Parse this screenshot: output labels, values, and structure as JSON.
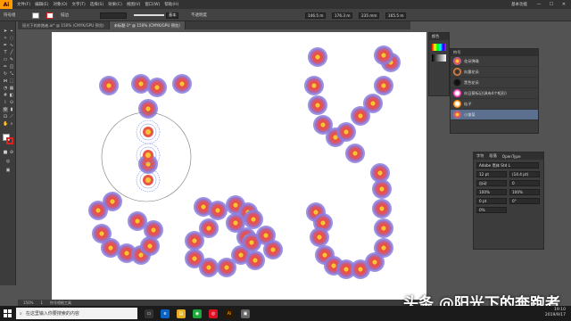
{
  "app": {
    "logo": "Ai",
    "workspace": "基本功能"
  },
  "menu": {
    "items": [
      "文件(F)",
      "编辑(E)",
      "对象(O)",
      "文字(T)",
      "选择(S)",
      "效果(C)",
      "视图(V)",
      "窗口(W)",
      "帮助(H)"
    ]
  },
  "window": {
    "min": "—",
    "max": "☐",
    "close": "✕"
  },
  "control": {
    "selection_label": "符号组",
    "stroke_label": "描边",
    "style_label": "基本",
    "opacity_label": "不透明度",
    "x_value": "146.5 m",
    "y_value": "176.3 m",
    "w_value": "235 mm",
    "h_value": "165.5 m"
  },
  "tabs": [
    {
      "label": "阳光下的奔跑者.ai* @ 150% (CMYK/GPU 预览)",
      "active": false
    },
    {
      "label": "未标题-1* @ 150% (CMYK/GPU 预览)",
      "active": true
    }
  ],
  "status": {
    "zoom": "150%",
    "page": "1",
    "tool": "符号喷枪工具"
  },
  "panels": {
    "swatch_tabs": [
      "颜色",
      "颜色参考"
    ],
    "symbols_title": "符号",
    "symbols": [
      "花朵弹珠",
      "向量花朵",
      "黑色花朵",
      "向日葵标记(具有4个矩形)",
      "桔子",
      "小雏菊"
    ],
    "selected_symbol": "小雏菊",
    "char_tabs": [
      "字符",
      "段落",
      "OpenType"
    ],
    "font_family": "Adobe 黑体 Std L",
    "font_size": "12 pt",
    "leading": "(14.4 pt)",
    "tracking": "0",
    "scale_h": "100%",
    "scale_v": "100%",
    "baseline": "0 pt",
    "rotation": "0°",
    "kerning": "自动",
    "tsume": "0%"
  },
  "taskbar": {
    "search_placeholder": "在这里输入你要搜索的内容",
    "time": "19:10",
    "date": "2019/9/17"
  },
  "watermark": "头条 @阳光下的奔跑者",
  "colors": {
    "artboard": "#ffffff",
    "workspace": "#535353",
    "petal_outer": "#8a7cdd",
    "petal_inner": "#e8564a",
    "center": "#f5c534",
    "accent": "#ff9a00"
  }
}
